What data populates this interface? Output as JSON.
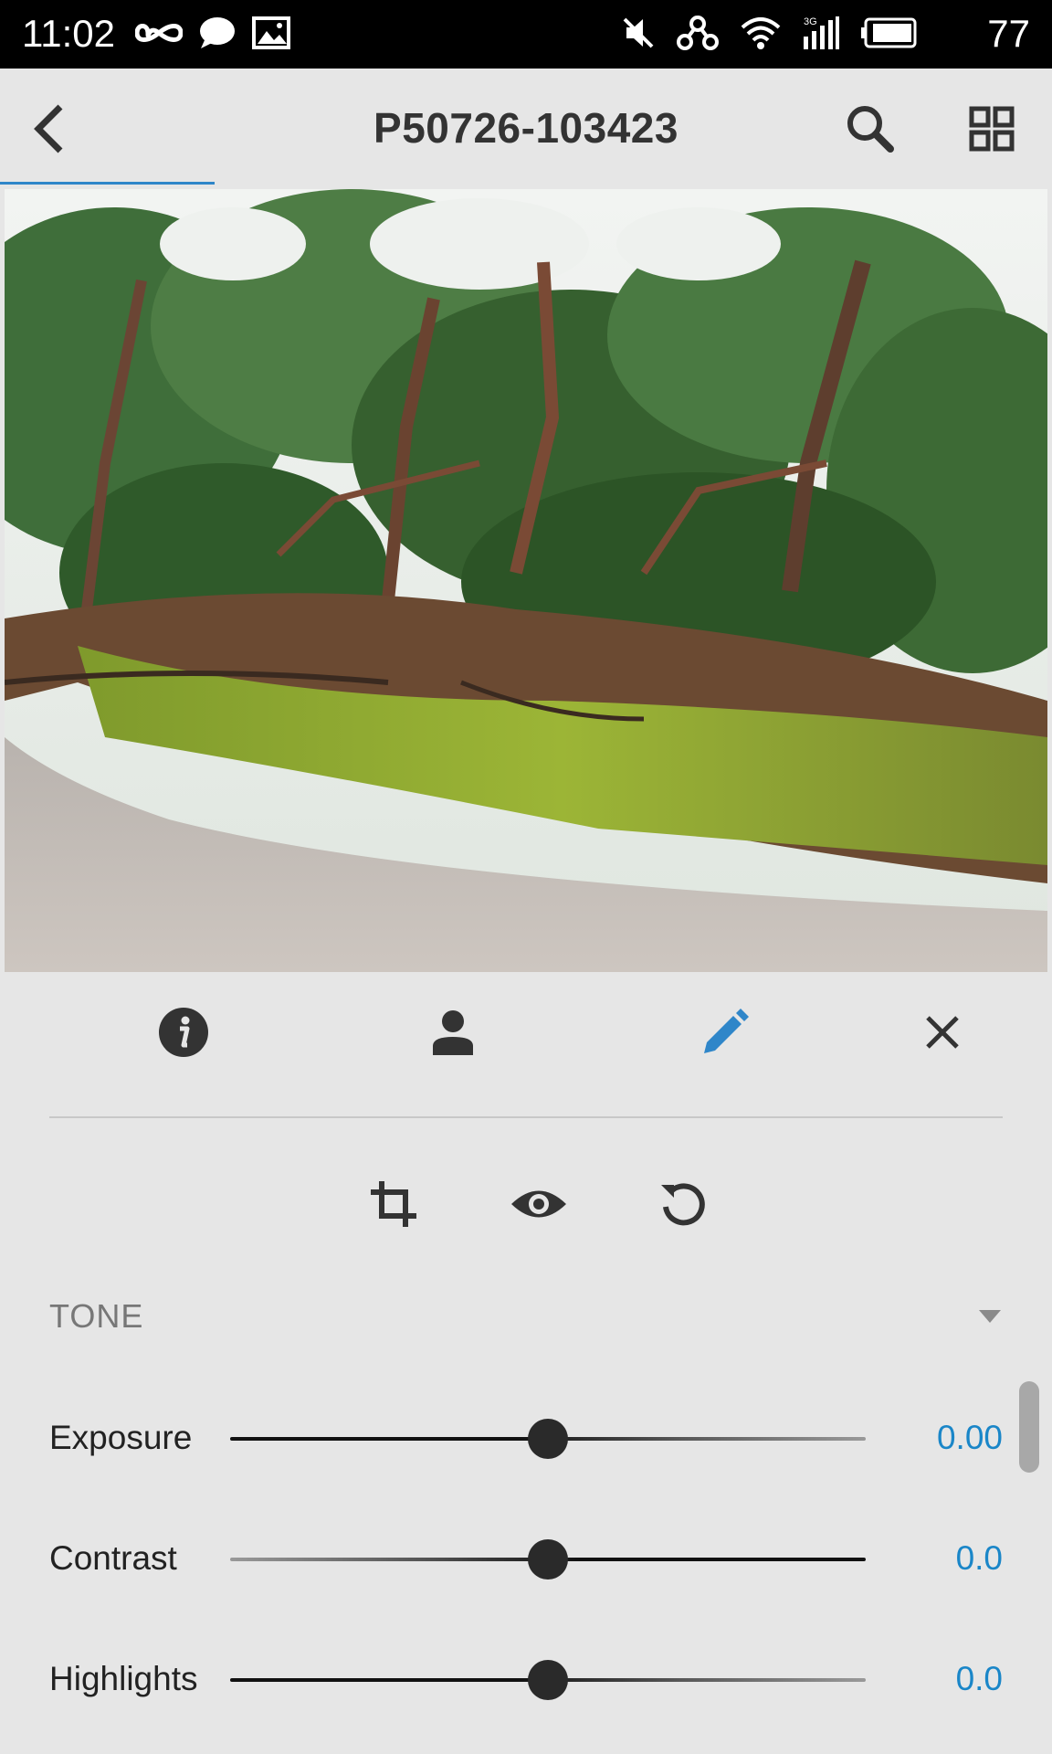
{
  "status_bar": {
    "time": "11:02",
    "battery_level": "77",
    "icons": [
      "infinity-icon",
      "chat-bubble-icon",
      "image-icon",
      "mute-icon",
      "link-icon",
      "wifi-icon",
      "signal-3g-icon",
      "battery-icon"
    ]
  },
  "app_bar": {
    "title": "P50726-103423"
  },
  "tabs": [
    "info-icon",
    "person-icon",
    "edit-pencil-icon",
    "close-icon"
  ],
  "tools": [
    "crop-icon",
    "eye-icon",
    "reset-icon"
  ],
  "section": {
    "title": "TONE"
  },
  "sliders": [
    {
      "label": "Exposure",
      "value": "0.00",
      "position": 0.5
    },
    {
      "label": "Contrast",
      "value": "0.0",
      "position": 0.5
    },
    {
      "label": "Highlights",
      "value": "0.0",
      "position": 0.5
    }
  ],
  "colors": {
    "accent": "#1a86c8",
    "active_tab": "#2f86c9"
  }
}
